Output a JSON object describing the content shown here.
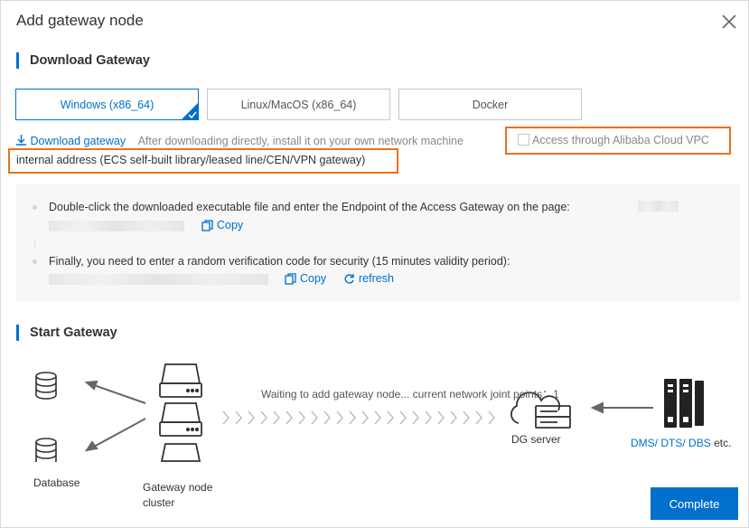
{
  "dialog": {
    "title": "Add gateway node"
  },
  "download_section": {
    "title": "Download Gateway",
    "tabs": [
      {
        "label": "Windows (x86_64)",
        "selected": true
      },
      {
        "label": "Linux/MacOS (x86_64)",
        "selected": false
      },
      {
        "label": "Docker",
        "selected": false
      }
    ],
    "download_link": "Download gateway",
    "download_hint": "After downloading directly, install it on your own network machine",
    "vpc_checkbox_label_line1": "Access through Alibaba Cloud VPC",
    "vpc_checkbox_label_line2": "internal address (ECS self-built library/leased line/CEN/VPN gateway)",
    "vpc_checked": false
  },
  "instructions": {
    "step1": "Double-click the downloaded executable file and enter the Endpoint of the Access Gateway on the page:",
    "step2": "Finally, you need to enter a random verification code for security (15 minutes validity period):",
    "copy_label": "Copy",
    "refresh_label": "refresh"
  },
  "start_section": {
    "title": "Start Gateway",
    "database_label": "Database",
    "cluster_label_line1": "Gateway node",
    "cluster_label_line2": "cluster",
    "waiting_text": "Waiting to add gateway node... current network joint points：",
    "joint_points": "1",
    "server_label": "DG server",
    "dms_label": "DMS/",
    "dts_label": "DTS/",
    "dbs_label": "DBS",
    "etc_label": "etc."
  },
  "footer": {
    "complete_label": "Complete"
  },
  "colors": {
    "accent": "#0070cc",
    "highlight": "#e8721f"
  }
}
